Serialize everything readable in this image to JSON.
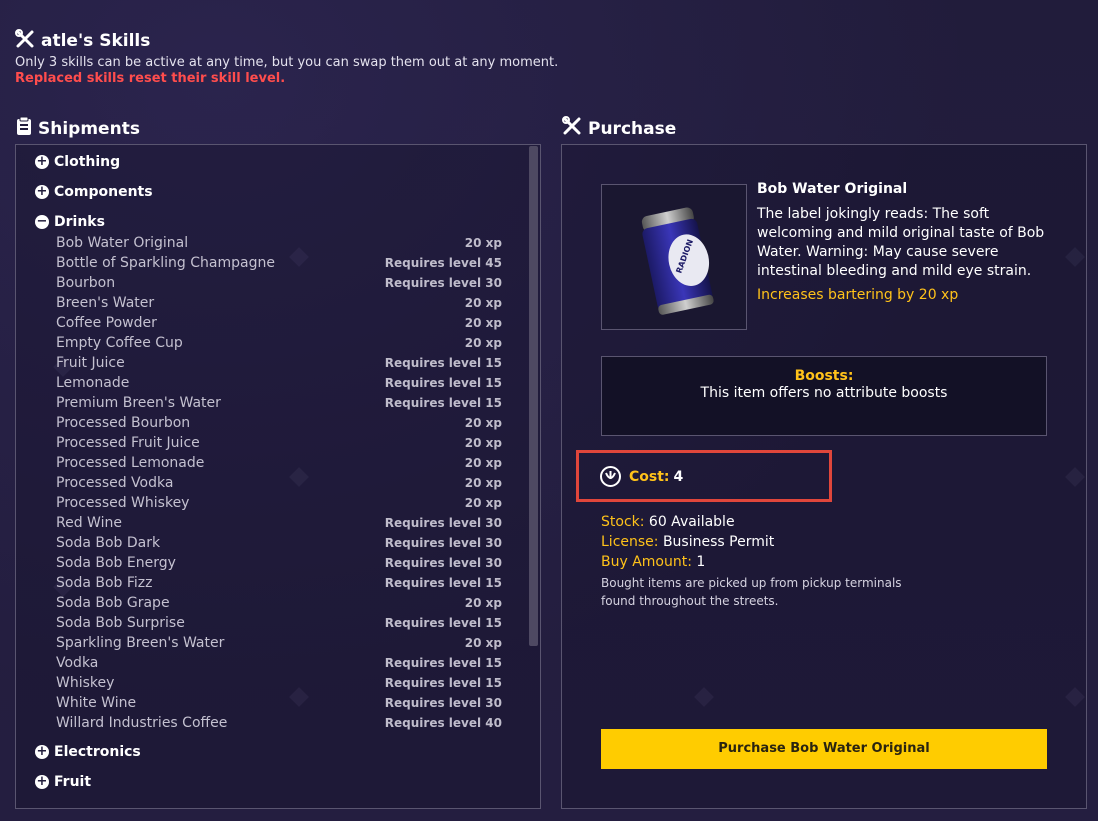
{
  "header": {
    "title": "atle's Skills",
    "description": "Only 3 skills can be active at any time, but you can swap them out at any moment.",
    "warning": "Replaced skills reset their skill level."
  },
  "shipments": {
    "title": "Shipments",
    "categories_top": [
      {
        "label": "Clothing",
        "expanded": false
      },
      {
        "label": "Components",
        "expanded": false
      },
      {
        "label": "Drinks",
        "expanded": true
      }
    ],
    "items": [
      {
        "name": "Bob Water Original",
        "requirement": "20 xp"
      },
      {
        "name": "Bottle of Sparkling Champagne",
        "requirement": "Requires level 45"
      },
      {
        "name": "Bourbon",
        "requirement": "Requires level 30"
      },
      {
        "name": "Breen's Water",
        "requirement": "20 xp"
      },
      {
        "name": "Coffee Powder",
        "requirement": "20 xp"
      },
      {
        "name": "Empty Coffee Cup",
        "requirement": "20 xp"
      },
      {
        "name": "Fruit Juice",
        "requirement": "Requires level 15"
      },
      {
        "name": "Lemonade",
        "requirement": "Requires level 15"
      },
      {
        "name": "Premium Breen's Water",
        "requirement": "Requires level 15"
      },
      {
        "name": "Processed Bourbon",
        "requirement": "20 xp"
      },
      {
        "name": "Processed Fruit Juice",
        "requirement": "20 xp"
      },
      {
        "name": "Processed Lemonade",
        "requirement": "20 xp"
      },
      {
        "name": "Processed Vodka",
        "requirement": "20 xp"
      },
      {
        "name": "Processed Whiskey",
        "requirement": "20 xp"
      },
      {
        "name": "Red Wine",
        "requirement": "Requires level 30"
      },
      {
        "name": "Soda Bob Dark",
        "requirement": "Requires level 30"
      },
      {
        "name": "Soda Bob Energy",
        "requirement": "Requires level 30"
      },
      {
        "name": "Soda Bob Fizz",
        "requirement": "Requires level 15"
      },
      {
        "name": "Soda Bob Grape",
        "requirement": "20 xp"
      },
      {
        "name": "Soda Bob Surprise",
        "requirement": "Requires level 15"
      },
      {
        "name": "Sparkling Breen's Water",
        "requirement": "20 xp"
      },
      {
        "name": "Vodka",
        "requirement": "Requires level 15"
      },
      {
        "name": "Whiskey",
        "requirement": "Requires level 15"
      },
      {
        "name": "White Wine",
        "requirement": "Requires level 30"
      },
      {
        "name": "Willard Industries Coffee",
        "requirement": "Requires level 40"
      }
    ],
    "categories_bottom": [
      {
        "label": "Electronics",
        "expanded": false
      },
      {
        "label": "Fruit",
        "expanded": false
      }
    ]
  },
  "purchase": {
    "title": "Purchase",
    "item_name": "Bob Water Original",
    "item_image_icon": "soda-can-icon",
    "can_label": "RADION",
    "item_description": "The label jokingly reads: The soft welcoming and mild original taste of Bob Water. Warning: May cause severe intestinal bleeding and mild eye strain.",
    "item_effect": "Increases bartering by 20 xp",
    "boosts_title": "Boosts:",
    "boosts_text": "This item offers no attribute boosts",
    "cost_label": "Cost:",
    "cost_value": "4",
    "cost_icon": "currency-token-icon",
    "stock_label": "Stock:",
    "stock_value": "60 Available",
    "license_label": "License:",
    "license_value": "Business Permit",
    "buy_amount_label": "Buy Amount:",
    "buy_amount_value": "1",
    "note": "Bought items are picked up from pickup terminals found throughout the streets.",
    "button_label": "Purchase Bob Water Original"
  },
  "colors": {
    "background": "#221d3d",
    "accent_yellow": "#ffc21a",
    "button_yellow": "#ffcc00",
    "warning_red": "#ff4d4d",
    "highlight_box": "#e0463b"
  }
}
